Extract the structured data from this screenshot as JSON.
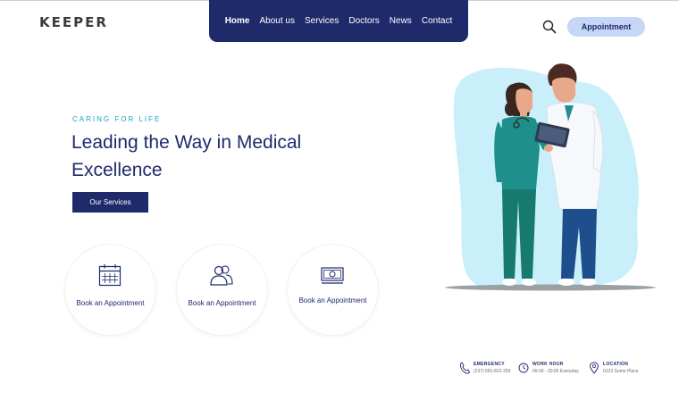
{
  "brand": {
    "logo": "KEEPER"
  },
  "nav": {
    "items": [
      {
        "label": "Home",
        "active": true
      },
      {
        "label": "About us"
      },
      {
        "label": "Services"
      },
      {
        "label": "Doctors"
      },
      {
        "label": "News"
      },
      {
        "label": "Contact"
      }
    ]
  },
  "header": {
    "search_icon": "search-icon",
    "appointment_label": "Appointment"
  },
  "hero": {
    "tagline": "CARING FOR LIFE",
    "headline": "Leading the Way in Medical Excellence",
    "cta_label": "Our Services"
  },
  "cards": [
    {
      "label": "Book an Appointment",
      "icon": "calendar-icon"
    },
    {
      "label": "Book an Appointment",
      "icon": "users-icon"
    },
    {
      "label": "Book an Appointment",
      "icon": "money-icon"
    }
  ],
  "contact": [
    {
      "title": "EMERGENCY",
      "value": "(237) 681-812-255",
      "icon": "phone-icon"
    },
    {
      "title": "WORK HOUR",
      "value": "09:00 - 20:00 Everyday",
      "icon": "clock-icon"
    },
    {
      "title": "LOCATION",
      "value": "0123 Some Place",
      "icon": "location-icon"
    }
  ],
  "colors": {
    "navy": "#1f2a6b",
    "accent": "#1aa3c7",
    "button_light": "#c5d6f7",
    "blob": "#c9effa"
  }
}
